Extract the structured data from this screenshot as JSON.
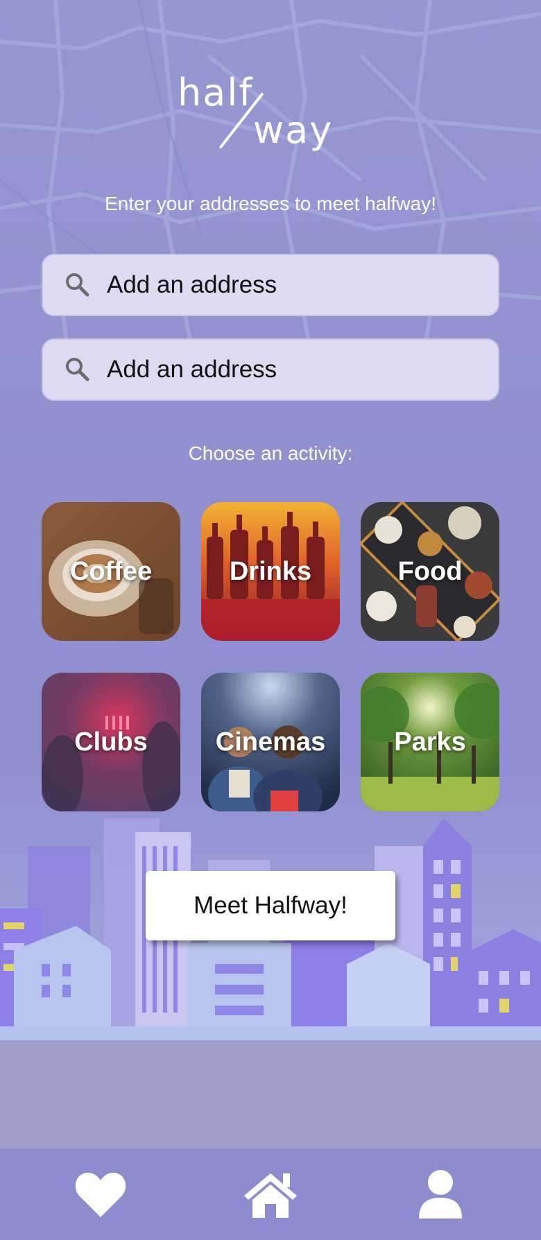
{
  "app": {
    "logo": {
      "part1": "half",
      "part2": "way"
    },
    "subtitle": "Enter your addresses to meet halfway!"
  },
  "address_inputs": [
    {
      "placeholder": "Add an address",
      "icon": "search-icon"
    },
    {
      "placeholder": "Add an address",
      "icon": "search-icon"
    }
  ],
  "activity": {
    "label": "Choose an activity:",
    "tiles": [
      {
        "label": "Coffee"
      },
      {
        "label": "Drinks"
      },
      {
        "label": "Food"
      },
      {
        "label": "Clubs"
      },
      {
        "label": "Cinemas"
      },
      {
        "label": "Parks"
      }
    ]
  },
  "cta": {
    "label": "Meet Halfway!"
  },
  "nav": [
    {
      "icon": "heart-icon"
    },
    {
      "icon": "home-icon"
    },
    {
      "icon": "user-icon"
    }
  ],
  "colors": {
    "background": "#9090cf",
    "input_bg": "#dedaf2",
    "navbar": "#8d8cce",
    "text": "#ffffff"
  }
}
